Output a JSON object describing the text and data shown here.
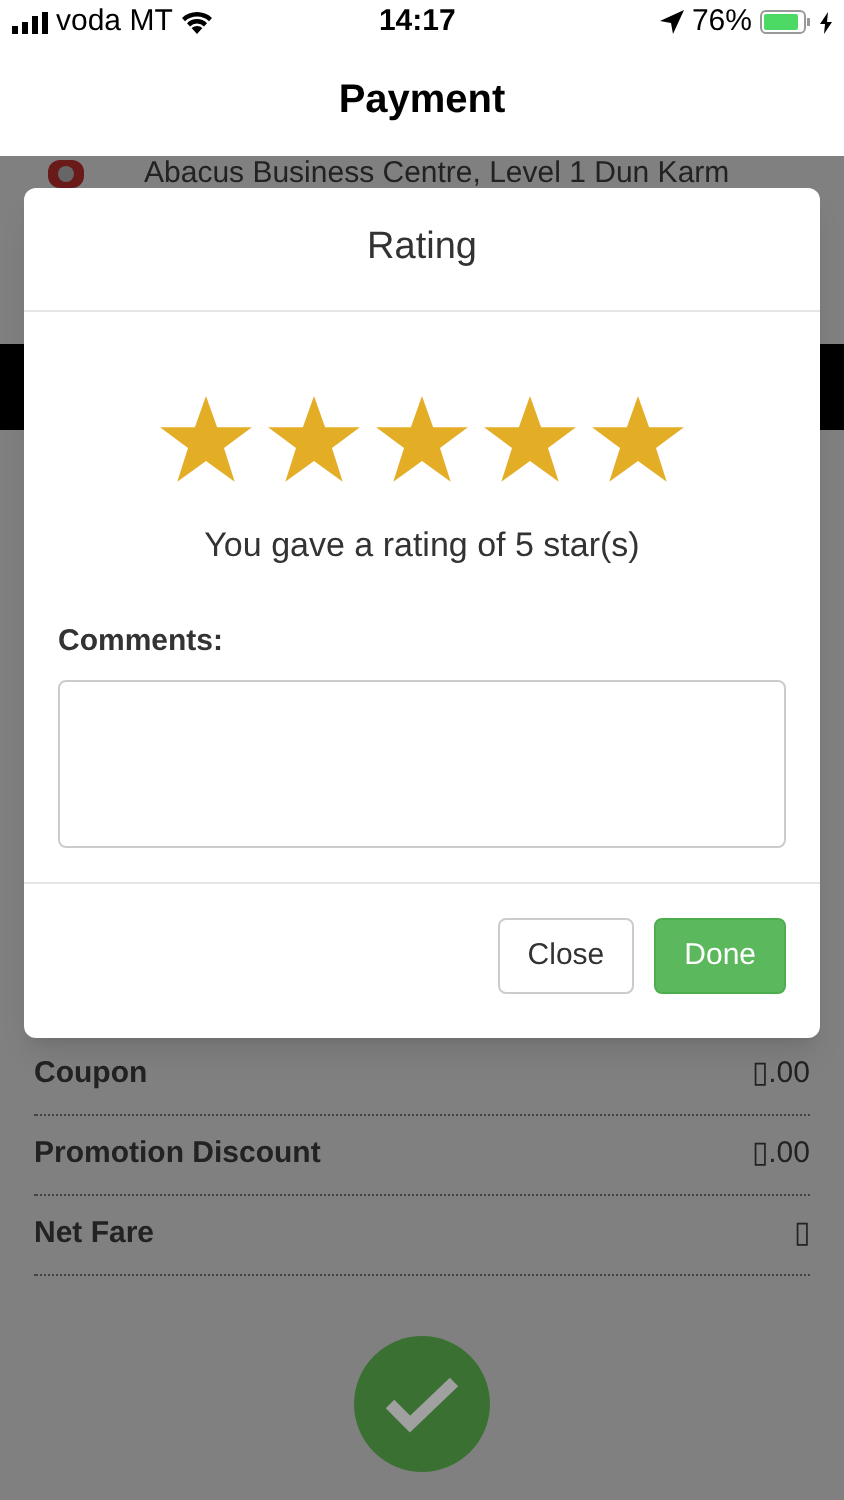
{
  "status_bar": {
    "carrier": "voda MT",
    "time": "14:17",
    "battery": "76%"
  },
  "header": {
    "title": "Payment"
  },
  "address": "Abacus Business Centre, Level 1 Dun Karm",
  "fare_rows": [
    {
      "label": "Coupon",
      "value": "▯.00"
    },
    {
      "label": "Promotion Discount",
      "value": "▯.00"
    },
    {
      "label": "Net Fare",
      "value": "▯"
    }
  ],
  "rating_dialog": {
    "title": "Rating",
    "stars": 5,
    "message": "You gave a rating of 5 star(s)",
    "comments_label": "Comments:",
    "buttons": [
      {
        "label": "Close",
        "kind": "secondary"
      },
      {
        "label": "Done",
        "kind": "primary"
      }
    ]
  }
}
